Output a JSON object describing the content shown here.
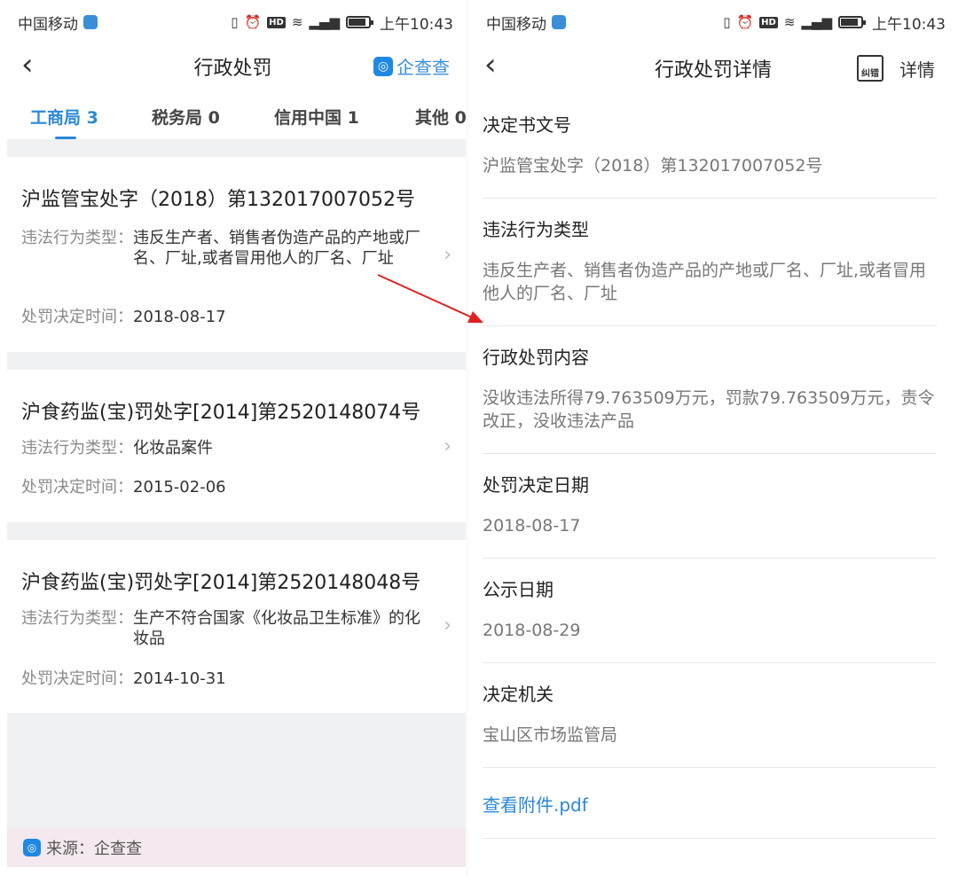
{
  "left": {
    "status": {
      "carrier": "中国移动",
      "time": "上午10:43"
    },
    "nav": {
      "back_icon": "chevron-left",
      "title": "行政处罚",
      "brand": "企查查"
    },
    "tabs": [
      {
        "label": "工商局 3",
        "active": true
      },
      {
        "label": "税务局 0",
        "active": false
      },
      {
        "label": "信用中国 1",
        "active": false
      },
      {
        "label": "其他 0",
        "active": false
      }
    ],
    "records": [
      {
        "title": "沪监管宝处字（2018）第132017007052号",
        "type_label": "违法行为类型：",
        "type_value": "违反生产者、销售者伪造产品的产地或厂名、厂址,或者冒用他人的厂名、厂址",
        "date_label": "处罚决定时间：",
        "date_value": "2018-08-17"
      },
      {
        "title": "沪食药监(宝)罚处字[2014]第2520148074号",
        "type_label": "违法行为类型：",
        "type_value": "化妆品案件",
        "date_label": "处罚决定时间：",
        "date_value": "2015-02-06"
      },
      {
        "title": "沪食药监(宝)罚处字[2014]第2520148048号",
        "type_label": "违法行为类型：",
        "type_value": "生产不符合国家《化妆品卫生标准》的化妆品",
        "date_label": "处罚决定时间：",
        "date_value": "2014-10-31"
      }
    ],
    "source": "来源：企查查"
  },
  "right": {
    "status": {
      "carrier": "中国移动",
      "time": "上午10:43"
    },
    "nav": {
      "title": "行政处罚详情",
      "correct_icon_text": "纠错",
      "detail_label": "详情"
    },
    "fields": [
      {
        "label": "决定书文号",
        "value": "沪监管宝处字（2018）第132017007052号"
      },
      {
        "label": "违法行为类型",
        "value": "违反生产者、销售者伪造产品的产地或厂名、厂址,或者冒用他人的厂名、厂址"
      },
      {
        "label": "行政处罚内容",
        "value": "没收违法所得79.763509万元，罚款79.763509万元，责令改正，没收违法产品"
      },
      {
        "label": "处罚决定日期",
        "value": "2018-08-17"
      },
      {
        "label": "公示日期",
        "value": "2018-08-29"
      },
      {
        "label": "决定机关",
        "value": "宝山区市场监管局"
      }
    ],
    "attachment": "查看附件.pdf"
  },
  "colors": {
    "accent": "#2b88d8",
    "arrow": "#e02020",
    "gap": "#eff1f3"
  }
}
